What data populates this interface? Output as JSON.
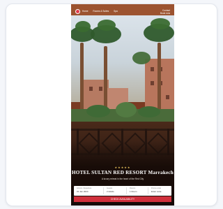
{
  "header": {
    "logo_icon": "hotel-logo-icon",
    "nav": [
      "Home",
      "Rooms & Suites",
      "Spa"
    ],
    "right_top": "Contact",
    "right_bottom": "Book now"
  },
  "hero": {
    "stars": "★★★★★",
    "hotel_name": "HOTEL SULTAN RED RESORT Marrakech",
    "tagline": "A luxury retreat in the heart of the Red City"
  },
  "booking": {
    "fields": [
      {
        "label": "Arrival - Departure",
        "value": "01 Jan 2024"
      },
      {
        "label": "Guests",
        "value": "2 Adults"
      },
      {
        "label": "Rooms",
        "value": "1 Room"
      },
      {
        "label": "Promo code",
        "value": "Enter code"
      }
    ],
    "button_label": "CHECK AVAILABILITY"
  },
  "colors": {
    "accent": "#d0303c",
    "arch": "#a85a34",
    "star": "#e7c15b"
  }
}
